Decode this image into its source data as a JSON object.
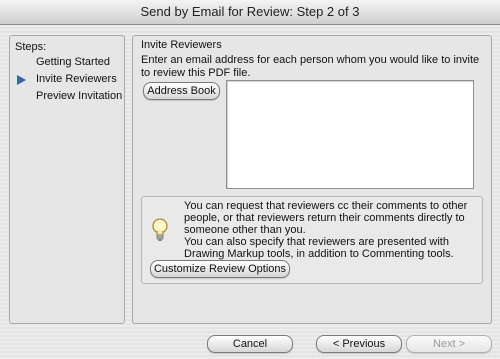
{
  "window": {
    "title": "Send by Email for Review: Step 2 of 3"
  },
  "steps": {
    "title": "Steps:",
    "items": [
      {
        "label": "Getting Started"
      },
      {
        "label": "Invite Reviewers"
      },
      {
        "label": "Preview Invitation"
      }
    ],
    "current_icon": "arrow-right-icon"
  },
  "main": {
    "section_title": "Invite Reviewers",
    "instructions": "Enter an email address for each person whom you would like to invite to review this PDF file.",
    "address_book_label": "Address Book",
    "emails_value": "",
    "tip": {
      "icon": "lightbulb-icon",
      "line1": "You can request that reviewers cc their comments to other people, or that reviewers return their comments directly to someone other than you.",
      "line2": "You can also specify that reviewers are presented with Drawing Markup tools, in addition to Commenting tools.",
      "customize_label": "Customize Review Options"
    }
  },
  "footer": {
    "cancel_label": "Cancel",
    "previous_label": "< Previous",
    "next_label": "Next >"
  }
}
